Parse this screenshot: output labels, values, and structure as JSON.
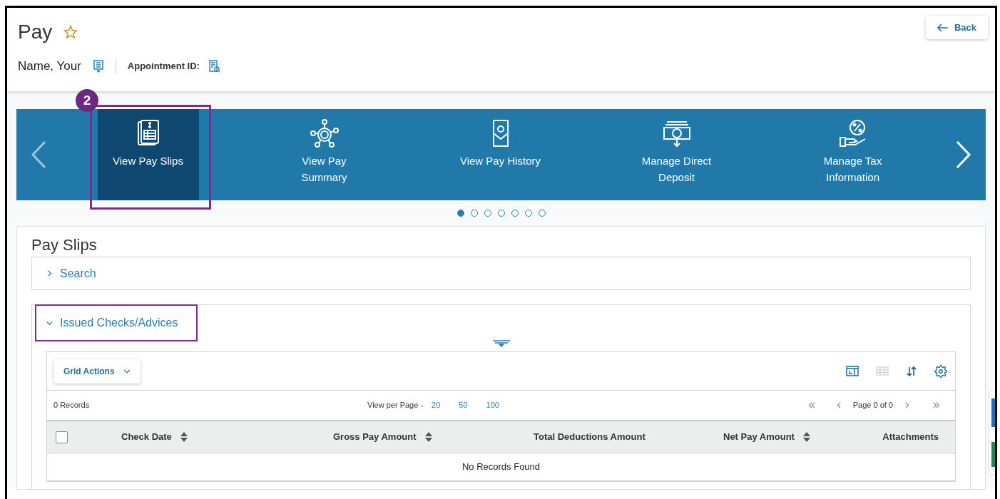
{
  "header": {
    "title": "Pay",
    "favorite": false,
    "back_button": "Back",
    "employee_name": "Name, Your",
    "appointment_label": "Appointment ID:"
  },
  "carousel": {
    "items": [
      {
        "label": "View Pay Slips",
        "kind": "slips",
        "selected": true
      },
      {
        "label": "View Pay Summary",
        "kind": "summary",
        "selected": false
      },
      {
        "label": "View Pay History",
        "kind": "history",
        "selected": false
      },
      {
        "label": "Manage Direct Deposit",
        "kind": "deposit",
        "selected": false
      },
      {
        "label": "Manage Tax Information",
        "kind": "tax",
        "selected": false
      }
    ],
    "pages": [
      {
        "selected": true
      },
      {
        "selected": false
      },
      {
        "selected": false
      },
      {
        "selected": false
      },
      {
        "selected": false
      },
      {
        "selected": false
      },
      {
        "selected": false
      }
    ]
  },
  "annotation": {
    "step": "2"
  },
  "panel": {
    "title": "Pay Slips",
    "sections": [
      {
        "label": "Search",
        "expanded": false
      },
      {
        "label": "Issued Checks/Advices",
        "expanded": true
      }
    ]
  },
  "grid": {
    "actions_button": "Grid Actions",
    "records": "0 Records",
    "per_page_label": "View per Page -",
    "per_page_options": [
      "20",
      "50",
      "100"
    ],
    "page_info": "Page 0 of 0",
    "select_all_checked": false,
    "columns": [
      {
        "label": "Check Date",
        "sortable": true
      },
      {
        "label": "Gross Pay Amount",
        "sortable": true
      },
      {
        "label": "Total Deductions Amount",
        "sortable": false
      },
      {
        "label": "Net Pay Amount",
        "sortable": true
      },
      {
        "label": "Attachments",
        "sortable": false
      }
    ],
    "empty_message": "No Records Found"
  }
}
